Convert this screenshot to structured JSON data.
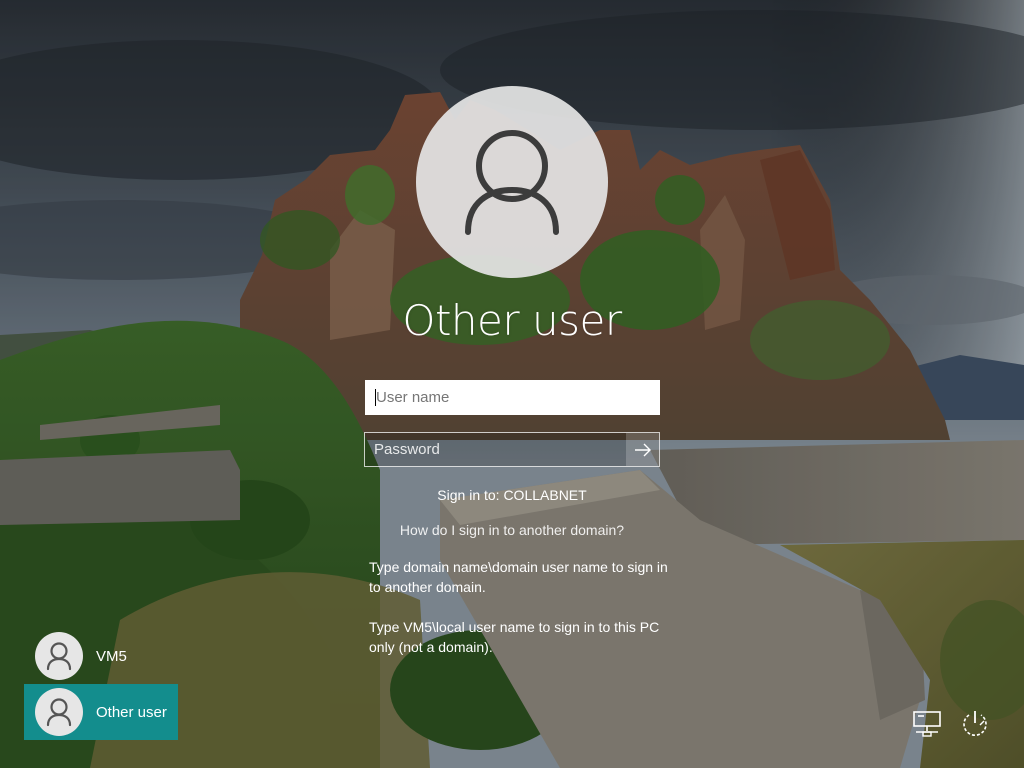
{
  "lock_screen": {
    "selected_user": "Other user",
    "username_placeholder": "User name",
    "password_placeholder": "Password",
    "sign_in_to": "Sign in to: COLLABNET",
    "help_link": "How do I sign in to another domain?",
    "help_text_1": "Type domain name\\domain user name to sign in to another domain.",
    "help_text_2": "Type VM5\\local user name to sign in to this PC only (not a domain).",
    "submit_icon": "arrow-right-icon",
    "avatar_icon": "user-silhouette-icon"
  },
  "user_list": [
    {
      "label": "VM5",
      "icon": "user-silhouette-icon",
      "selected": false
    },
    {
      "label": "Other user",
      "icon": "user-silhouette-icon",
      "selected": true
    }
  ],
  "system_icons": {
    "network": "network-icon",
    "power": "power-icon"
  },
  "colors": {
    "selected_tile": "#138d8d",
    "avatar_background": "#e4e4e4"
  }
}
